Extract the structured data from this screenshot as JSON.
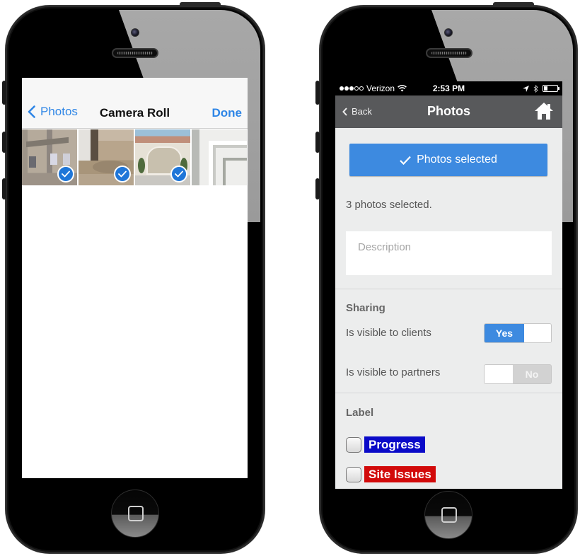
{
  "left_phone": {
    "nav": {
      "back_label": "Photos",
      "title": "Camera Roll",
      "done_label": "Done"
    },
    "thumbnails": [
      {
        "name": "house-exterior",
        "selected": true
      },
      {
        "name": "flooded-yard",
        "selected": true
      },
      {
        "name": "garage-door",
        "selected": true
      },
      {
        "name": "window-frame",
        "selected": false
      }
    ]
  },
  "right_phone": {
    "status_bar": {
      "carrier": "Verizon",
      "signal_bars_filled": 3,
      "signal_bars_total": 5,
      "time": "2:53 PM",
      "icons": [
        "location-arrow-icon",
        "bluetooth-icon",
        "battery-icon"
      ]
    },
    "header": {
      "back_label": "Back",
      "title": "Photos",
      "home_icon": "home-icon"
    },
    "primary_button": {
      "label": "Photos selected",
      "icon": "checkmark-icon",
      "color": "#3d8ae0"
    },
    "selected_count_text": "3 photos selected.",
    "description": {
      "placeholder": "Description",
      "value": ""
    },
    "sharing": {
      "title": "Sharing",
      "rows": [
        {
          "label": "Is visible to clients",
          "state": "Yes",
          "on": true
        },
        {
          "label": "Is visible to partners",
          "state": "No",
          "on": false
        }
      ]
    },
    "label_section": {
      "title": "Label",
      "options": [
        {
          "label": "Progress",
          "color": "#0a0ac8",
          "checked": false
        },
        {
          "label": "Site Issues",
          "color": "#d20a0a",
          "checked": false
        }
      ]
    }
  }
}
